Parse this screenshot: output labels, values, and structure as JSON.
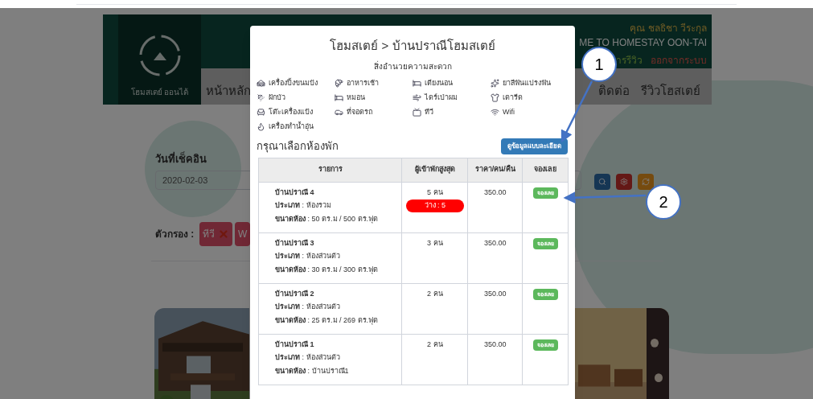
{
  "header": {
    "logo_text": "โฮมสเตย์ ออนไต้",
    "user_name": "คุณ ชลธิชา วีระกุล",
    "welcome": "ME TO HOMESTAY OON-TAI",
    "links": [
      "ารรีวิว",
      "ออกจากระบบ"
    ],
    "nav": [
      "หน้าหลัก",
      "ติดต่อ",
      "รีวิวโฮสเตย์"
    ]
  },
  "search": {
    "checkin_label": "วันที่เช็คอิน",
    "checkin_value": "2020-02-03"
  },
  "filter": {
    "label": "ตัวกรอง :",
    "chips": [
      "ทีวี",
      "W"
    ]
  },
  "modal": {
    "title": "โฮมสเตย์ > บ้านปราณีโฮมสเตย์",
    "amenities_heading": "สิ่งอำนวยความสะดวก",
    "amenities": [
      "เครื่องปิ้งขนมปัง",
      "อาหารเช้า",
      "เตียงนอน",
      "ยาสีฟันแปรงฟัน",
      "ฝักบัว",
      "หมอน",
      "ไดร์เป่าผม",
      "เตารีด",
      "โต๊ะเครื่องแป้ง",
      "ที่จอดรถ",
      "ทีวี",
      "Wifi",
      "เครื่องทำน้ำอุ่น"
    ],
    "rooms_heading": "กรุณาเลือกห้องพัก",
    "details_button": "ดูข้อมูลแบบละเอียด",
    "columns": [
      "รายการ",
      "ผู้เข้าพักสูงสุด",
      "ราคา/คน/คืน",
      "จองเลย"
    ],
    "rows": [
      {
        "name": "บ้านปราณี 4",
        "type_line": "**ประเภท** : ห้องรวม",
        "size_line": "**ขนาดห้อง** : 50 ตร.ม / 500 ตร.ฟุต",
        "guests": "5 คน",
        "availability": "ว่าง : 5",
        "price": "350.00",
        "book": "จองเลย"
      },
      {
        "name": "บ้านปราณี 3",
        "type_line": "**ประเภท** : ห้องส่วนตัว",
        "size_line": "**ขนาดห้อง** : 30 ตร.ม / 300 ตร.ฟุต",
        "guests": "3 คน",
        "price": "350.00",
        "book": "จองเลย"
      },
      {
        "name": "บ้านปราณี 2",
        "type_line": "**ประเภท** : ห้องส่วนตัว",
        "size_line": "**ขนาดห้อง** : 25 ตร.ม / 269 ตร.ฟุต",
        "guests": "2 คน",
        "price": "350.00",
        "book": "จองเลย"
      },
      {
        "name": "บ้านปราณี 1",
        "type_line": "**ประเภท** : ห้องส่วนตัว",
        "size_line": "**ขนาดห้อง** : บ้านปราณี1",
        "guests": "2 คน",
        "price": "350.00",
        "book": "จองเลย"
      }
    ]
  },
  "callouts": [
    "1",
    "2"
  ]
}
